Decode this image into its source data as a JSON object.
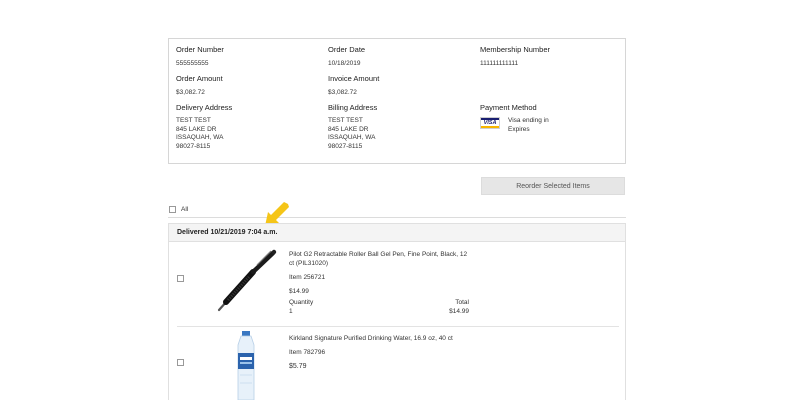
{
  "order": {
    "order_number_label": "Order Number",
    "order_number": "555555555",
    "order_date_label": "Order Date",
    "order_date": "10/18/2019",
    "membership_label": "Membership Number",
    "membership": "111111111111",
    "order_amount_label": "Order Amount",
    "order_amount": "$3,082.72",
    "invoice_amount_label": "Invoice Amount",
    "invoice_amount": "$3,082.72",
    "delivery_label": "Delivery Address",
    "delivery": [
      "TEST TEST",
      "845 LAKE DR",
      "ISSAQUAH, WA",
      "98027-8115"
    ],
    "billing_label": "Billing Address",
    "billing": [
      "TEST TEST",
      "845 LAKE DR",
      "ISSAQUAH, WA",
      "98027-8115"
    ],
    "payment_label": "Payment Method",
    "payment_line1": "Visa ending in",
    "payment_line2": "Expires",
    "card_brand": "VISA"
  },
  "reorder_button": "Reorder Selected Items",
  "select_all_label": "All",
  "delivered": "Delivered 10/21/2019 7:04 a.m.",
  "colors": {
    "arrow": "#f5c518",
    "visa_blue": "#1a1f71",
    "visa_gold": "#f7b600"
  },
  "items": [
    {
      "title": "Pilot G2 Retractable Roller Ball Gel Pen, Fine Point, Black, 12 ct (PIL31020)",
      "item_no": "Item 256721",
      "price": "$14.99",
      "quantity_label": "Quantity",
      "quantity": "1",
      "total_label": "Total",
      "total": "$14.99",
      "image": "pen-image"
    },
    {
      "title": "Kirkland Signature Purified Drinking Water, 16.9 oz, 40 ct",
      "item_no": "Item 782796",
      "price": "$5.79",
      "image": "water-bottle-image"
    }
  ]
}
